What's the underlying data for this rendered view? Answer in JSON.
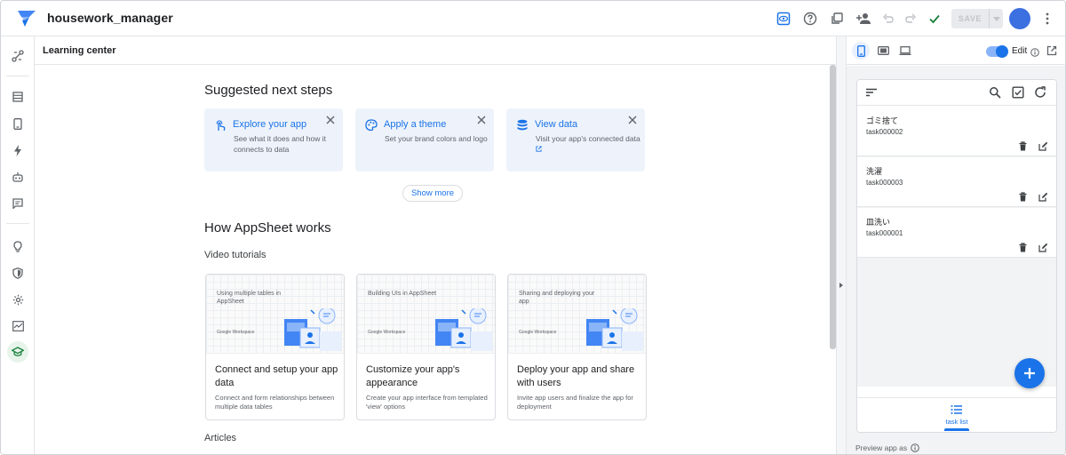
{
  "app": {
    "title": "housework_manager"
  },
  "toolbar": {
    "save_label": "SAVE"
  },
  "section": {
    "title": "Learning center"
  },
  "suggested": {
    "heading": "Suggested next steps",
    "cards": [
      {
        "title": "Explore your app",
        "desc": "See what it does and how it connects to data",
        "icon": "touch-icon"
      },
      {
        "title": "Apply a theme",
        "desc": "Set your brand colors and logo",
        "icon": "palette-icon"
      },
      {
        "title": "View data",
        "desc": "Visit your app's connected data",
        "icon": "database-icon"
      }
    ],
    "show_more": "Show more"
  },
  "how": {
    "heading": "How AppSheet works",
    "video_heading": "Video tutorials",
    "videos": [
      {
        "thumb": "Using multiple tables in AppSheet",
        "brand": "Google Workspace",
        "title": "Connect and setup your app data",
        "desc": "Connect and form relationships between multiple data tables"
      },
      {
        "thumb": "Building UIs in AppSheet",
        "brand": "Google Workspace",
        "title": "Customize your app's appearance",
        "desc": "Create your app interface from templated 'view' options"
      },
      {
        "thumb": "Sharing and deploying your app",
        "brand": "Google Workspace",
        "title": "Deploy your app and share with users",
        "desc": "Invite app users and finalize the app for deployment"
      }
    ],
    "articles_heading": "Articles"
  },
  "preview": {
    "edit_label": "Edit",
    "footer": "Preview app as",
    "rows": [
      {
        "name": "ゴミ捨て",
        "id": "task000002"
      },
      {
        "name": "洗濯",
        "id": "task000003"
      },
      {
        "name": "皿洗い",
        "id": "task000001"
      }
    ],
    "nav_label": "task list"
  },
  "colors": {
    "accent": "#1a73e8",
    "success": "#188038",
    "card_bg": "#eef3fb"
  }
}
